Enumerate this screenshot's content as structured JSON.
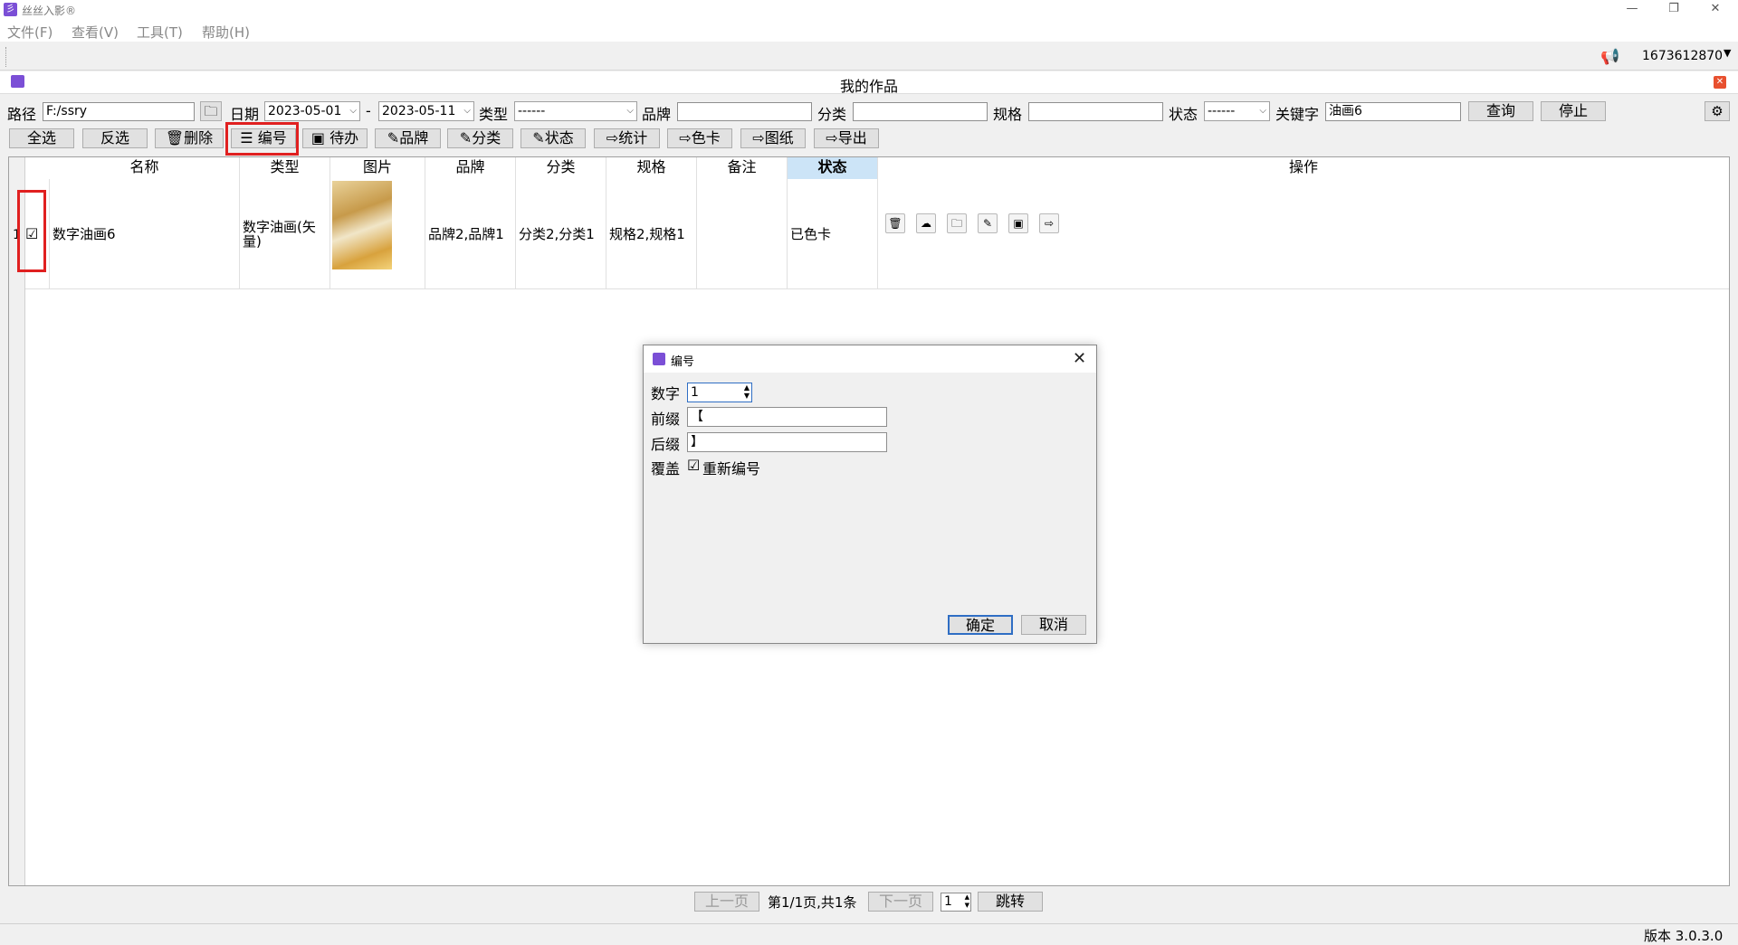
{
  "app": {
    "title": "丝丝入影®"
  },
  "menu": [
    "文件(F)",
    "查看(V)",
    "工具(T)",
    "帮助(H)"
  ],
  "user": {
    "id": "1673612870"
  },
  "panel": {
    "title": "我的作品"
  },
  "filters": {
    "path_label": "路径",
    "path_value": "F:/ssry",
    "date_label": "日期",
    "date_from": "2023-05-01",
    "date_sep": "-",
    "date_to": "2023-05-11",
    "type_label": "类型",
    "type_value": "------",
    "brand_label": "品牌",
    "brand_value": "",
    "category_label": "分类",
    "category_value": "",
    "spec_label": "规格",
    "spec_value": "",
    "status_label": "状态",
    "status_value": "------",
    "keyword_label": "关键字",
    "keyword_value": "油画6",
    "query_button": "查询",
    "stop_button": "停止"
  },
  "actions": {
    "select_all": "全选",
    "invert": "反选",
    "delete": "删除",
    "number": "编号",
    "todo": "待办",
    "brand": "品牌",
    "category": "分类",
    "status": "状态",
    "stats": "统计",
    "color_card": "色卡",
    "drawing": "图纸",
    "export": "导出"
  },
  "table": {
    "columns": [
      "名称",
      "类型",
      "图片",
      "品牌",
      "分类",
      "规格",
      "备注",
      "状态",
      "操作"
    ],
    "rows": [
      {
        "num": "1",
        "checked": "☑",
        "name": "数字油画6",
        "type": "数字油画(矢量)",
        "brand": "品牌2,品牌1",
        "category": "分类2,分类1",
        "spec": "规格2,规格1",
        "note": "",
        "status": "已色卡"
      }
    ]
  },
  "dialog": {
    "title": "编号",
    "number_label": "数字",
    "number_value": "1",
    "prefix_label": "前缀",
    "prefix_value": "【",
    "suffix_label": "后缀",
    "suffix_value": "】",
    "overwrite_label": "覆盖",
    "renumber_label": "重新编号",
    "renumber_check": "☑",
    "ok_button": "确定",
    "cancel_button": "取消"
  },
  "pager": {
    "prev": "上一页",
    "info": "第1/1页,共1条",
    "next": "下一页",
    "page_value": "1",
    "jump": "跳转"
  },
  "status": {
    "version": "版本 3.0.3.0"
  },
  "colors": {
    "accent": "#7b4fd6",
    "highlight_header": "#cce4f7",
    "annotation_red": "#e02020"
  }
}
